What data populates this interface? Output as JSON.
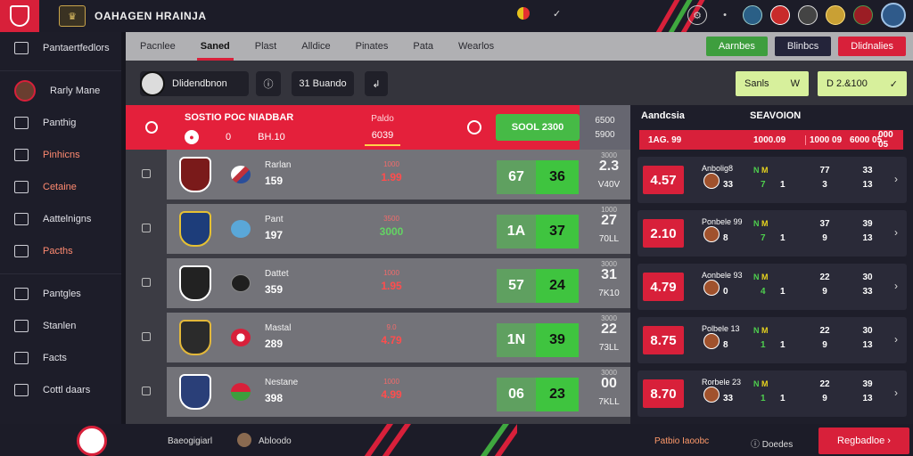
{
  "topbar": {
    "title": "OAHAGEN HRAINJA",
    "chevron": "✓",
    "icons": [
      "settings-icon",
      "more-icon",
      "flag-icon",
      "team-icon",
      "user-icon",
      "medal-icon",
      "club-icon"
    ]
  },
  "sidebar": {
    "items": [
      {
        "label": "Pantaertfedlors",
        "icon": "menu-icon"
      },
      {
        "label": "Rarly Mane",
        "icon": "user-avatar"
      },
      {
        "label": "Panthig",
        "icon": "bookmark-icon"
      },
      {
        "label": "Pinhicns",
        "icon": "tag-icon",
        "accent": true
      },
      {
        "label": "Cetaine",
        "icon": "grid-icon",
        "accent": true
      },
      {
        "label": "Aattelnigns",
        "icon": "folder-icon"
      },
      {
        "label": "Pacths",
        "icon": "home-icon",
        "accent": true
      },
      {
        "label": "Pantgles",
        "icon": "layout-icon"
      },
      {
        "label": "Stanlen",
        "icon": "list-icon"
      },
      {
        "label": "Facts",
        "icon": "box-icon"
      },
      {
        "label": "Cottl daars",
        "icon": "leaf-icon"
      }
    ]
  },
  "tabs": [
    "Pacnlee",
    "Saned",
    "Plast",
    "Alldice",
    "Pinates",
    "Pata",
    "Wearlos"
  ],
  "tab_actions": {
    "green": "Aarnbes",
    "dark": "Blinbcs",
    "red": "Dlidnalies"
  },
  "filters": {
    "player": "Dlidendbnon",
    "icon_btn": "ⓘ",
    "mid_btn": "31 Buando",
    "arrow_btn": "↲",
    "sel1": "Sanls",
    "sel1_val": "W",
    "sel2": "D 2.&100",
    "sel2_suffix": "✓"
  },
  "header": {
    "title": "SOSTIO POC NIADBAR",
    "sub1": "0",
    "sub2": "BH.10",
    "mid_top": "Paldo",
    "mid_bottom": "6039",
    "green": "SOOL 2300",
    "right_top": "6500",
    "right_bottom": "5900"
  },
  "rows": [
    {
      "name": "Rarlan",
      "num": "159",
      "odds_lbl": "1000",
      "odds": "1.99",
      "odds_color": "red",
      "s1": "67",
      "s2": "36",
      "r3s": "3000",
      "r3a": "2.3",
      "r3b": "V40V"
    },
    {
      "name": "Pant",
      "num": "197",
      "odds_lbl": "3500",
      "odds": "3000",
      "odds_color": "green",
      "s1": "1A",
      "s2": "37",
      "r3s": "1000",
      "r3a": "27",
      "r3b": "70LL"
    },
    {
      "name": "Dattet",
      "num": "359",
      "odds_lbl": "1000",
      "odds": "1.95",
      "odds_color": "red",
      "s1": "57",
      "s2": "24",
      "r3s": "3000",
      "r3a": "31",
      "r3b": "7K10"
    },
    {
      "name": "Mastal",
      "num": "289",
      "odds_lbl": "9.0",
      "odds": "4.79",
      "odds_color": "red",
      "s1": "1N",
      "s2": "39",
      "r3s": "3000",
      "r3a": "22",
      "r3b": "73LL"
    },
    {
      "name": "Nestane",
      "num": "398",
      "odds_lbl": "1000",
      "odds": "4.99",
      "odds_color": "red",
      "s1": "06",
      "s2": "23",
      "r3s": "3000",
      "r3a": "00",
      "r3b": "7KLL"
    }
  ],
  "rpanel": {
    "head1": "Aandcsia",
    "head2": "SEAVOION",
    "bar": [
      "1AG. 99",
      "1000.09",
      "1000 09",
      "6000 05",
      "000 05"
    ],
    "rows": [
      {
        "val": "4.57",
        "lbl": "Anbolig8",
        "n1": "33",
        "gy": [
          "N",
          "M"
        ],
        "g2": "7",
        "w2": "1",
        "c3a": "77",
        "c3b": "3",
        "c4a": "33",
        "c4b": "13"
      },
      {
        "val": "2.10",
        "lbl": "Ponbele 99",
        "n1": "8",
        "gy": [
          "N",
          "M"
        ],
        "g2": "7",
        "w2": "1",
        "c3a": "37",
        "c3b": "9",
        "c4a": "39",
        "c4b": "13"
      },
      {
        "val": "4.79",
        "lbl": "Aonbele 93",
        "n1": "0",
        "gy": [
          "N",
          "M"
        ],
        "g2": "4",
        "w2": "1",
        "c3a": "22",
        "c3b": "9",
        "c4a": "30",
        "c4b": "33"
      },
      {
        "val": "8.75",
        "lbl": "Polbele 13",
        "n1": "8",
        "gy": [
          "N",
          "M"
        ],
        "g2": "1",
        "w2": "1",
        "c3a": "22",
        "c3b": "9",
        "c4a": "30",
        "c4b": "13"
      },
      {
        "val": "8.70",
        "lbl": "Rorbele 23",
        "n1": "33",
        "gy": [
          "N",
          "M"
        ],
        "g2": "1",
        "w2": "1",
        "c3a": "22",
        "c3b": "9",
        "c4a": "39",
        "c4b": "13"
      }
    ]
  },
  "bottombar": {
    "text1": "Baeogigiarl",
    "text2": "Abloodo",
    "link1": "Patbio Iaoobc",
    "link2": "ⓘ Doedes",
    "btn": "Regbadloe ›"
  },
  "colors": {
    "accent": "#d8203a",
    "green": "#3fc43f",
    "lime": "#d7f09c"
  }
}
